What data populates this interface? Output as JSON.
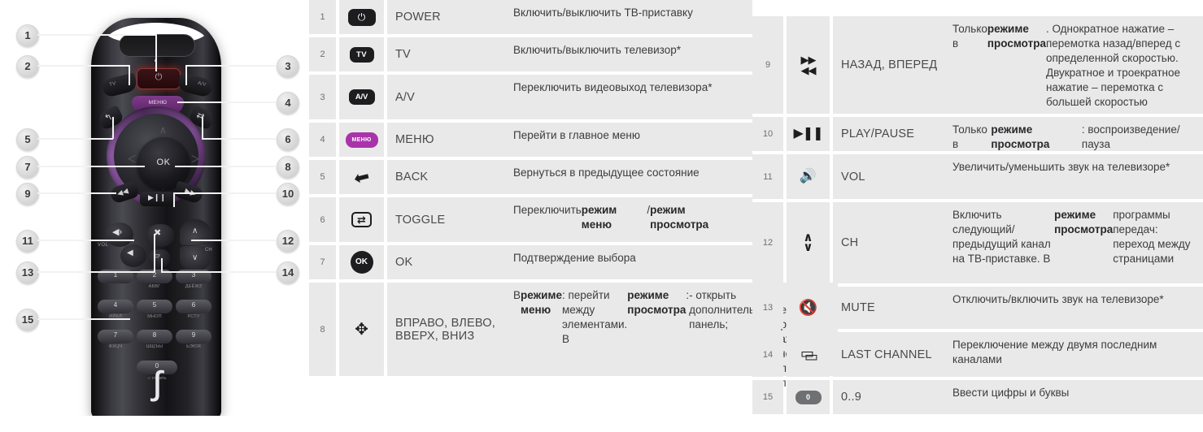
{
  "illustration": {
    "alt": "rostelecom-remote-control-diagram",
    "remote": {
      "power_glyph": "⏻",
      "tv_label": "TV",
      "av_label": "A/V",
      "menu_label": "МЕНЮ",
      "ok_label": "OK",
      "back_glyph": "↰",
      "toggle_glyph": "⇄",
      "rewind_glyph": "◀◀",
      "forward_glyph": "▶▶",
      "playpause_glyph": "▶❙❙",
      "volup_glyph": "🔊",
      "voldown_glyph": "🔈",
      "vol_label": "VOL",
      "mute_glyph": "🔇",
      "lastchannel_glyph": "▱",
      "ch_up_glyph": "∧",
      "ch_down_glyph": "∨",
      "ch_label": "CH",
      "logo_glyph": "ꭍ",
      "keys": [
        {
          "n": "1",
          "sub": ""
        },
        {
          "n": "2",
          "sub": "АБВГ"
        },
        {
          "n": "3",
          "sub": "ДЕЁЖЗ"
        },
        {
          "n": "4",
          "sub": "ИЙКЛ"
        },
        {
          "n": "5",
          "sub": "МНОП"
        },
        {
          "n": "6",
          "sub": "РСТУ"
        },
        {
          "n": "7",
          "sub": "ФХЦЧ"
        },
        {
          "n": "8",
          "sub": "ШЩЪЫ"
        },
        {
          "n": "9",
          "sub": "ЬЭЮЯ"
        }
      ],
      "key_zero": "0",
      "key_zero_sub": "стереть"
    },
    "callouts": [
      "1",
      "2",
      "3",
      "4",
      "5",
      "6",
      "7",
      "8",
      "9",
      "10",
      "11",
      "12",
      "13",
      "14",
      "15"
    ]
  },
  "table": {
    "left_rows": [
      {
        "num": "1",
        "icon": "power-icon",
        "icon_text": "⏻",
        "name": "POWER",
        "desc_parts": [
          {
            "t": "Включить/выключить ТВ-приставку",
            "b": false
          }
        ]
      },
      {
        "num": "2",
        "icon": "tv-icon",
        "icon_text": "TV",
        "name": "TV",
        "desc_parts": [
          {
            "t": "Включить/выключить телевизор*",
            "b": false
          }
        ]
      },
      {
        "num": "3",
        "icon": "av-icon",
        "icon_text": "A/V",
        "name": "A/V",
        "desc_parts": [
          {
            "t": "Переключить видеовыход телевизора*",
            "b": false
          }
        ]
      },
      {
        "num": "4",
        "icon": "menu-icon",
        "icon_text": "МЕНЮ",
        "name": "МЕНЮ",
        "desc_parts": [
          {
            "t": "Перейти в главное меню",
            "b": false
          }
        ]
      },
      {
        "num": "5",
        "icon": "back-arrow-icon",
        "icon_text": "↰",
        "name": "BACK",
        "desc_parts": [
          {
            "t": "Вернуться в предыдущее состояние",
            "b": false
          }
        ]
      },
      {
        "num": "6",
        "icon": "toggle-icon",
        "icon_text": "⇄",
        "name": "TOGGLE",
        "desc_parts": [
          {
            "t": "Переключить ",
            "b": false
          },
          {
            "t": "режим меню",
            "b": true
          },
          {
            "t": " / ",
            "b": false
          },
          {
            "t": "режим просмотра",
            "b": true
          }
        ]
      },
      {
        "num": "7",
        "icon": "ok-icon",
        "icon_text": "OK",
        "name": "OK",
        "desc_parts": [
          {
            "t": "Подтверждение выбора",
            "b": false
          }
        ]
      },
      {
        "num": "8",
        "icon": "dpad-icon",
        "icon_text": "✥",
        "name": "ВПРАВО, ВЛЕВО, ВВЕРХ, ВНИЗ",
        "desc_parts": [
          {
            "t": "В ",
            "b": false
          },
          {
            "t": "режиме меню",
            "b": true
          },
          {
            "t": ": перейти между элементами. В ",
            "b": false
          },
          {
            "t": "режиме просмотра",
            "b": true
          },
          {
            "t": ":\n- открыть дополнительную панель;\n- перемотка при зажатой кнопке влево/вправо",
            "b": false
          }
        ]
      }
    ],
    "right_rows": [
      {
        "num": "9",
        "icon": "rewind-forward-icon",
        "icon_text": "▶▶ ◀◀",
        "name": "НАЗАД, ВПЕРЕД",
        "desc_parts": [
          {
            "t": "Только в ",
            "b": false
          },
          {
            "t": "режиме просмотра",
            "b": true
          },
          {
            "t": ". Однократное нажатие – перемотка назад/вперед с определенной скоростью. Двукратное и троекратное нажатие – перемотка с большей скоростью",
            "b": false
          }
        ]
      },
      {
        "num": "10",
        "icon": "play-pause-icon",
        "icon_text": "▶❙❙",
        "name": "PLAY/PAUSE",
        "desc_parts": [
          {
            "t": "Только в ",
            "b": false
          },
          {
            "t": "режиме просмотра",
            "b": true
          },
          {
            "t": ": воспроизведение/пауза",
            "b": false
          }
        ]
      },
      {
        "num": "11",
        "icon": "volume-icon",
        "icon_text": "◀",
        "name": "VOL",
        "desc_parts": [
          {
            "t": "Увеличить/уменьшить звук на телевизоре*",
            "b": false
          }
        ]
      },
      {
        "num": "12",
        "icon": "channel-up-down-icon",
        "icon_text": "∧ ∨",
        "name": "CH",
        "desc_parts": [
          {
            "t": "Включить следующий/ предыдущий канал на ТВ-приставке. В ",
            "b": false
          },
          {
            "t": "режиме просмотра",
            "b": true
          },
          {
            "t": " программы передач: переход между страницами",
            "b": false
          }
        ]
      },
      {
        "num": "13",
        "icon": "mute-icon",
        "icon_text": "✖",
        "name": "MUTE",
        "desc_parts": [
          {
            "t": "Отключить/включить звук на телевизоре*",
            "b": false
          }
        ]
      },
      {
        "num": "14",
        "icon": "last-channel-icon",
        "icon_text": "▱",
        "name": "LAST CHANNEL",
        "desc_parts": [
          {
            "t": "Переключение между двумя последним каналами",
            "b": false
          }
        ]
      },
      {
        "num": "15",
        "icon": "digit-zero-icon",
        "icon_text": "0",
        "name": "0..9",
        "desc_parts": [
          {
            "t": "Ввести цифры и буквы",
            "b": false
          }
        ]
      }
    ]
  },
  "colors": {
    "cell_bg": "#e9e9e9",
    "page_bg": "#ffffff",
    "icon_dark": "#1d1d20",
    "menu_purple": "#a933aa",
    "text": "#3c3c3f",
    "num_text": "#6f6f72"
  }
}
